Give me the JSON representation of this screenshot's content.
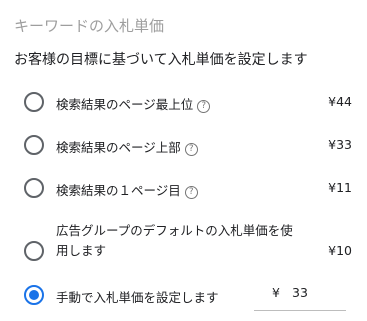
{
  "section_title": "キーワードの入札単価",
  "instruction": "お客様の目標に基づいて入札単価を設定します",
  "options": [
    {
      "label": "検索結果のページ最上位",
      "help": "?",
      "price": "¥44",
      "selected": false
    },
    {
      "label": "検索結果のページ上部",
      "help": "?",
      "price": "¥33",
      "selected": false
    },
    {
      "label": "検索結果の１ページ目",
      "help": "?",
      "price": "¥11",
      "selected": false
    },
    {
      "label": "広告グループのデフォルトの入札単価を使用します",
      "price": "¥10",
      "selected": false
    },
    {
      "label": "手動で入札単価を設定します",
      "selected": true,
      "currency": "¥",
      "value": "33"
    }
  ],
  "colors": {
    "accent": "#1a73e8",
    "muted_title": "#9e9e9e"
  }
}
